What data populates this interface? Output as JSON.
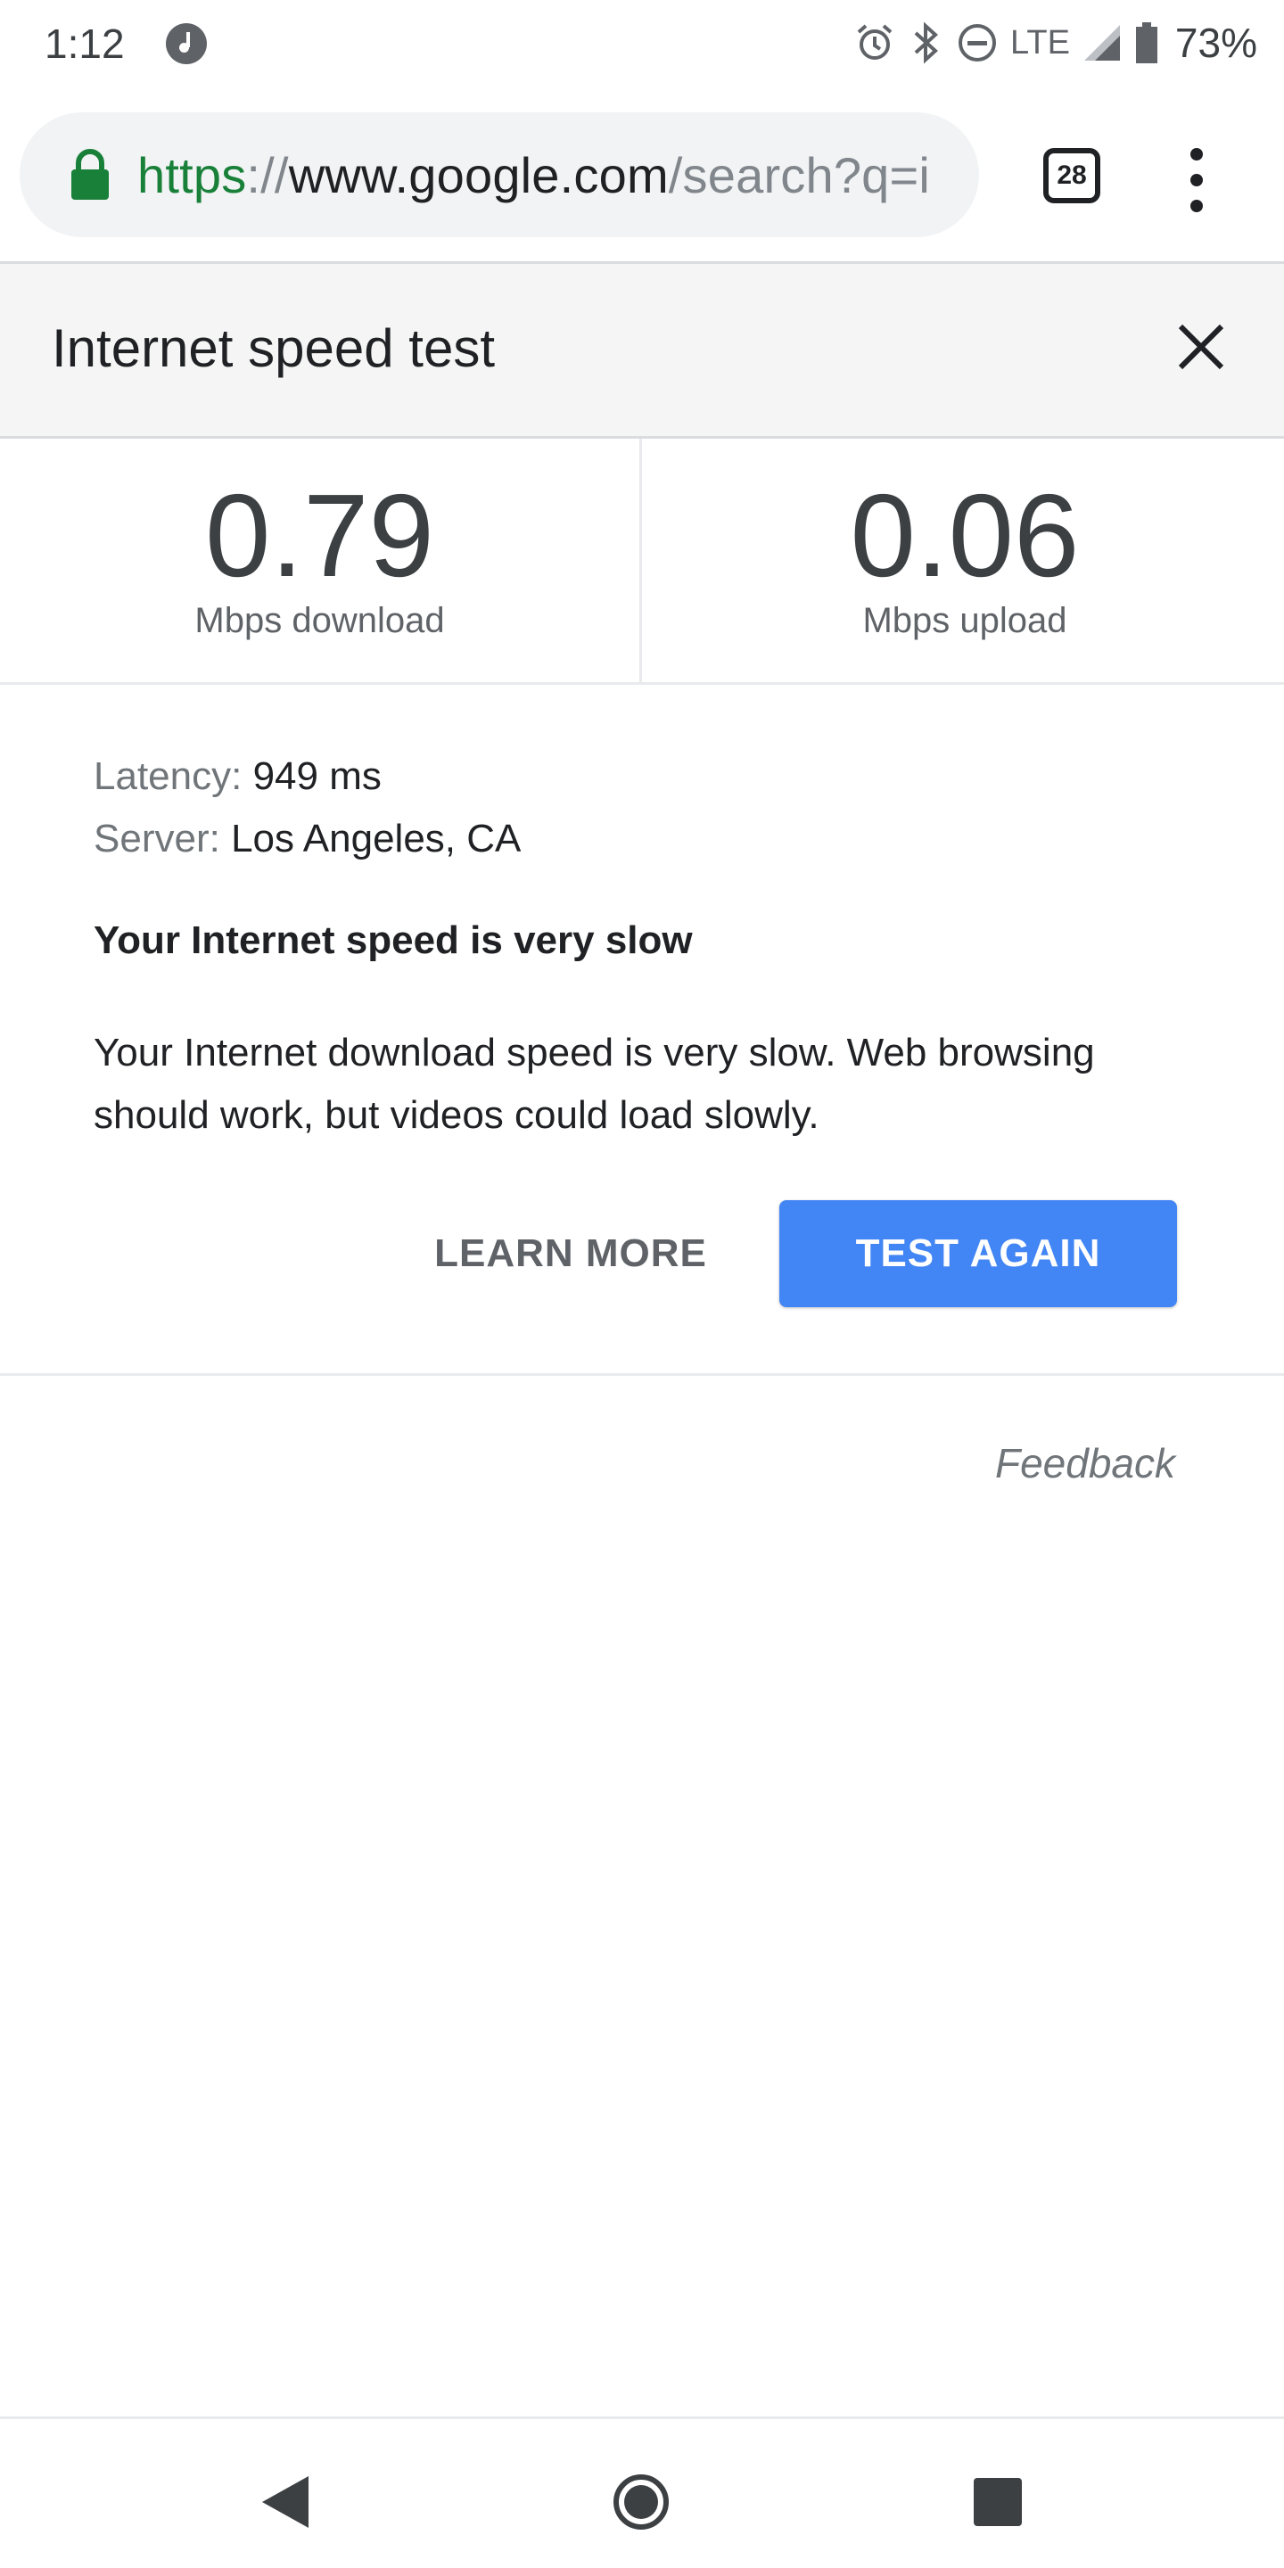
{
  "status_bar": {
    "time": "1:12",
    "network": "LTE",
    "battery_percent": "73%"
  },
  "browser": {
    "url": {
      "scheme": "https",
      "separator": "://",
      "host": "www.google.com",
      "path": "/search?q=i"
    },
    "tab_count": "28"
  },
  "speed_test": {
    "title": "Internet speed test",
    "download": {
      "value": "0.79",
      "label": "Mbps download"
    },
    "upload": {
      "value": "0.06",
      "label": "Mbps upload"
    },
    "latency": {
      "key": "Latency:",
      "value": "949 ms"
    },
    "server": {
      "key": "Server:",
      "value": "Los Angeles, CA"
    },
    "verdict": "Your Internet speed is very slow",
    "description": "Your Internet download speed is very slow. Web browsing should work, but videos could load slowly.",
    "learn_more_label": "LEARN MORE",
    "test_again_label": "TEST AGAIN",
    "feedback_label": "Feedback"
  },
  "colors": {
    "accent": "#4285f4",
    "secure": "#188038"
  }
}
